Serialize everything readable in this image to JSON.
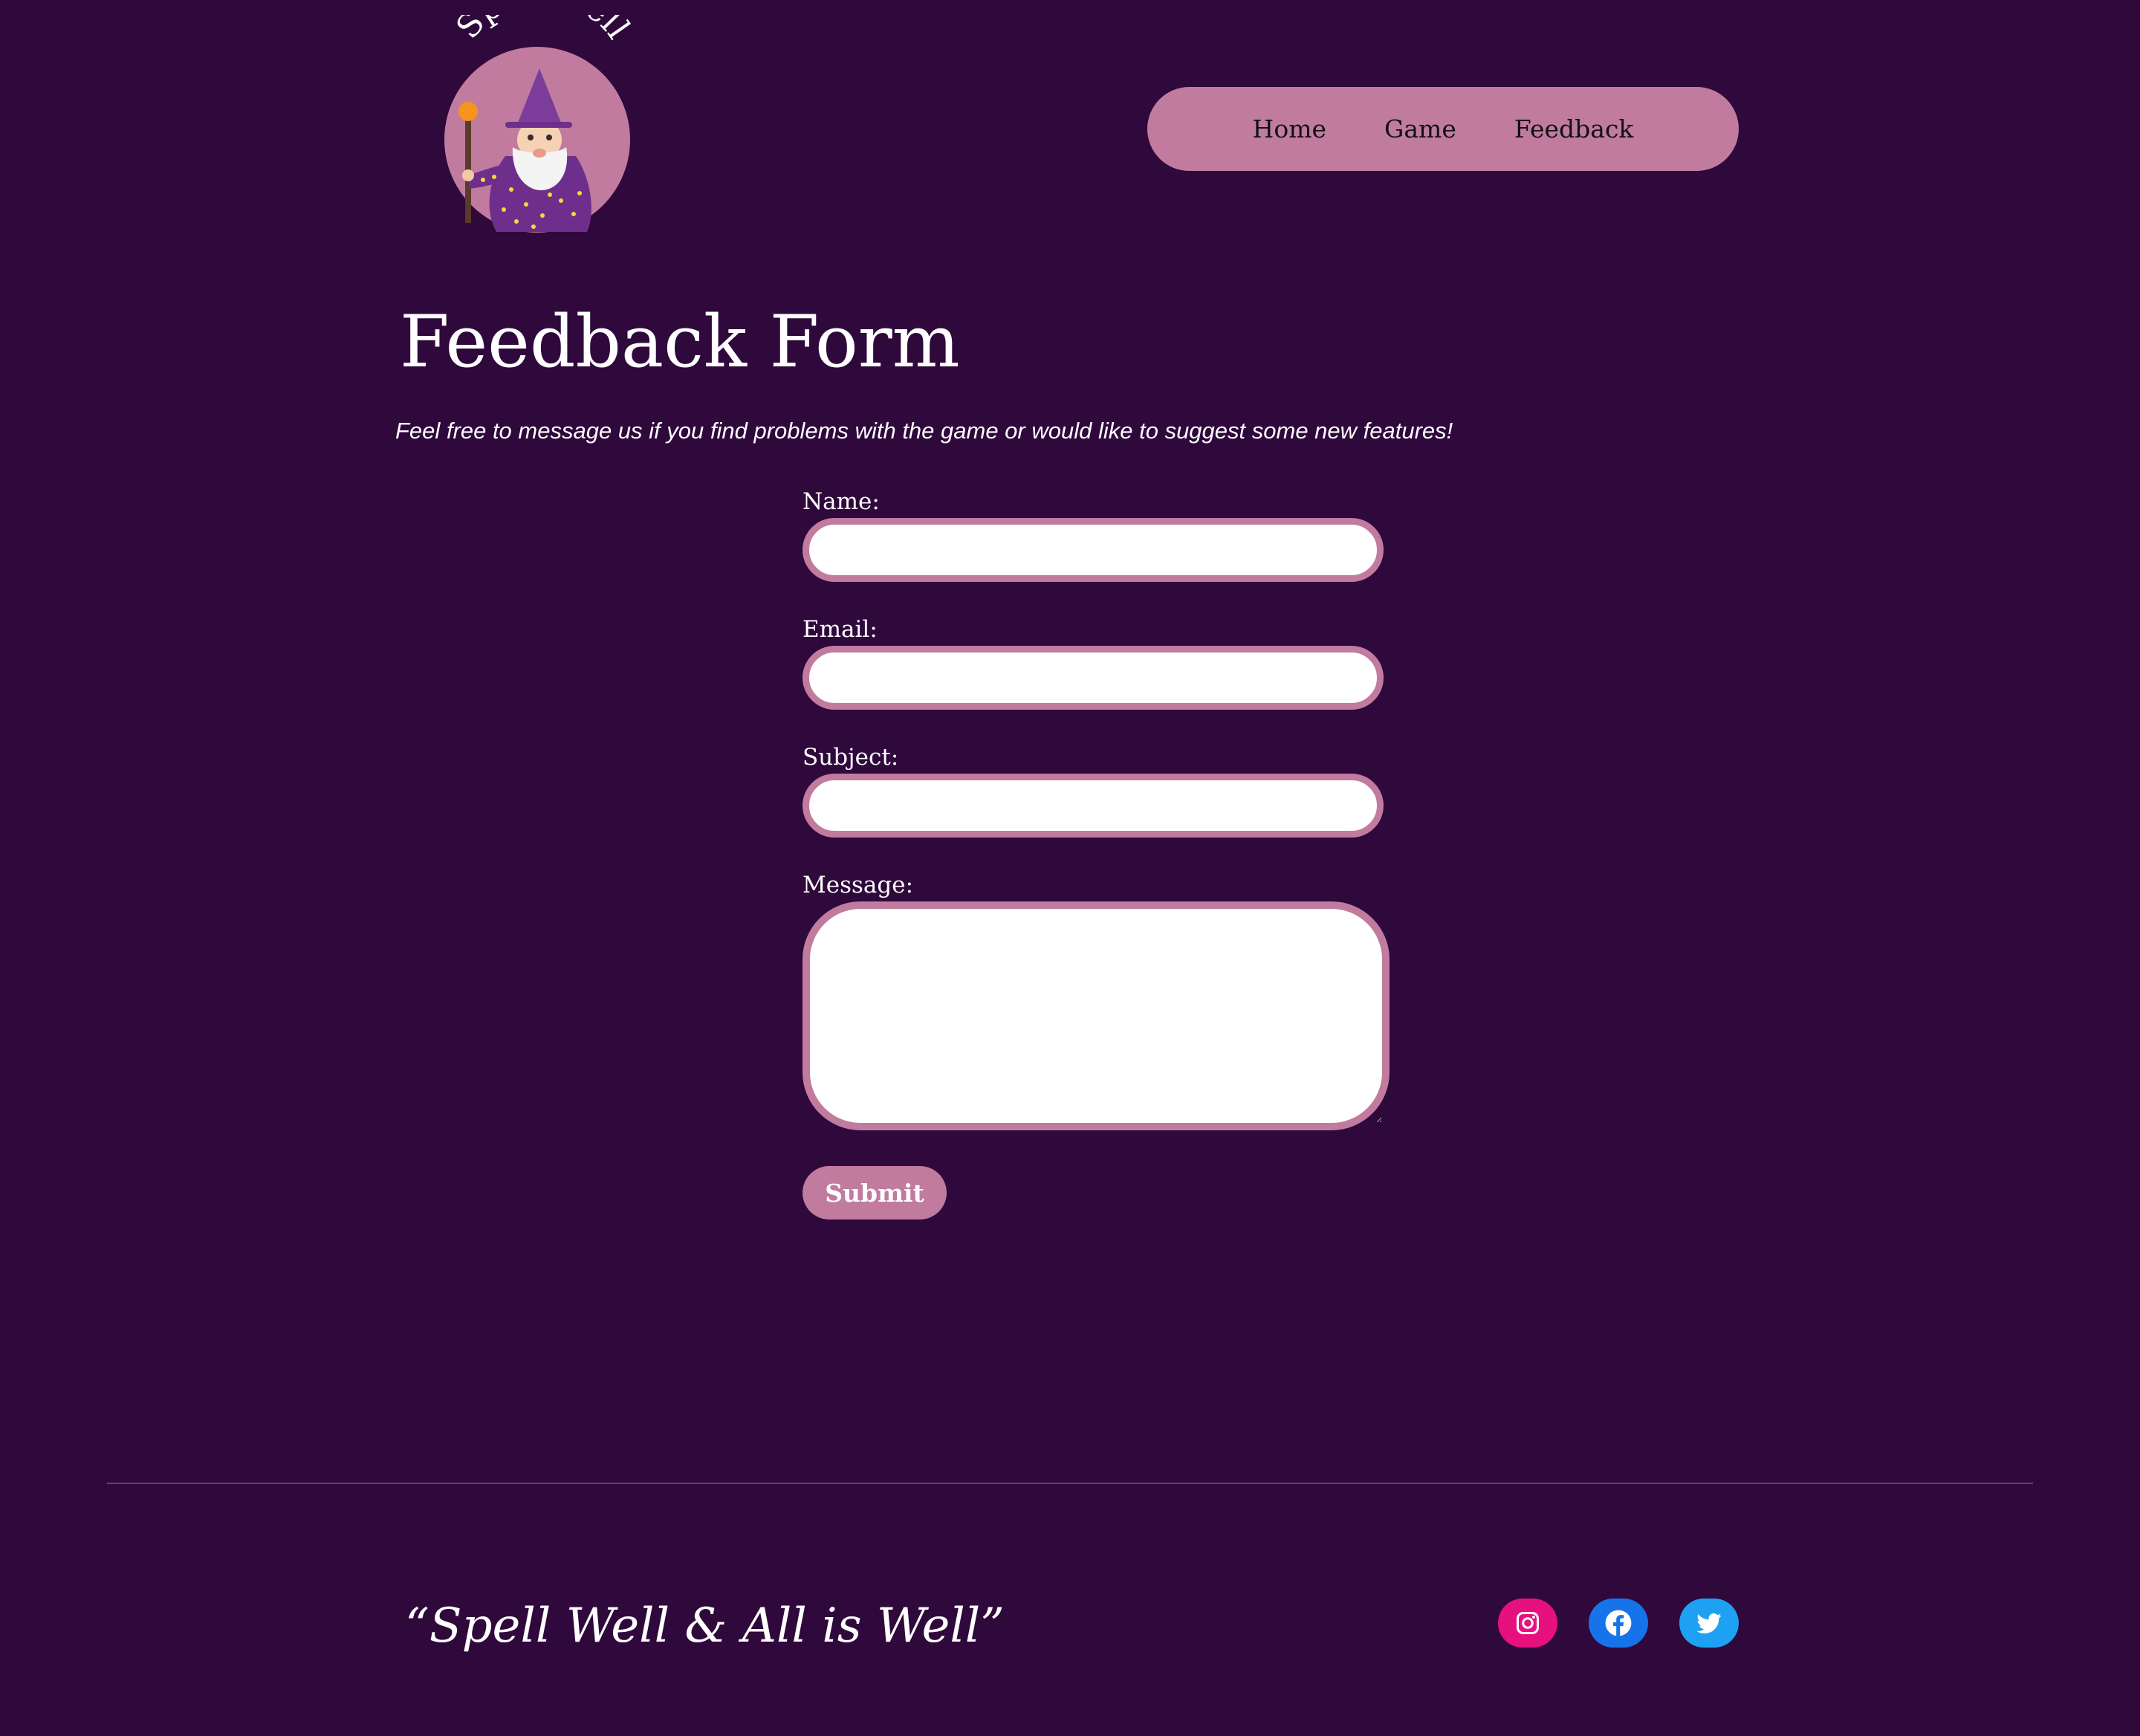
{
  "brand": {
    "logo_text": "Spell Well"
  },
  "nav": {
    "items": [
      {
        "label": "Home"
      },
      {
        "label": "Game"
      },
      {
        "label": "Feedback"
      }
    ]
  },
  "main": {
    "title": "Feedback Form",
    "intro": "Feel free to message us if you find problems with the game or would like to suggest some new features!"
  },
  "form": {
    "name_label": "Name:",
    "name_value": "",
    "email_label": "Email:",
    "email_value": "",
    "subject_label": "Subject:",
    "subject_value": "",
    "message_label": "Message:",
    "message_value": "",
    "submit_label": "Submit"
  },
  "footer": {
    "tagline": "“Spell Well & All is Well”",
    "socials": [
      {
        "icon": "instagram-icon",
        "color": "#e6107e"
      },
      {
        "icon": "facebook-icon",
        "color": "#1773ea"
      },
      {
        "icon": "twitter-icon",
        "color": "#1ea1f2"
      }
    ]
  },
  "colors": {
    "background": "#2f083c",
    "accent": "#c17b9f",
    "divider": "#6b3e74"
  }
}
